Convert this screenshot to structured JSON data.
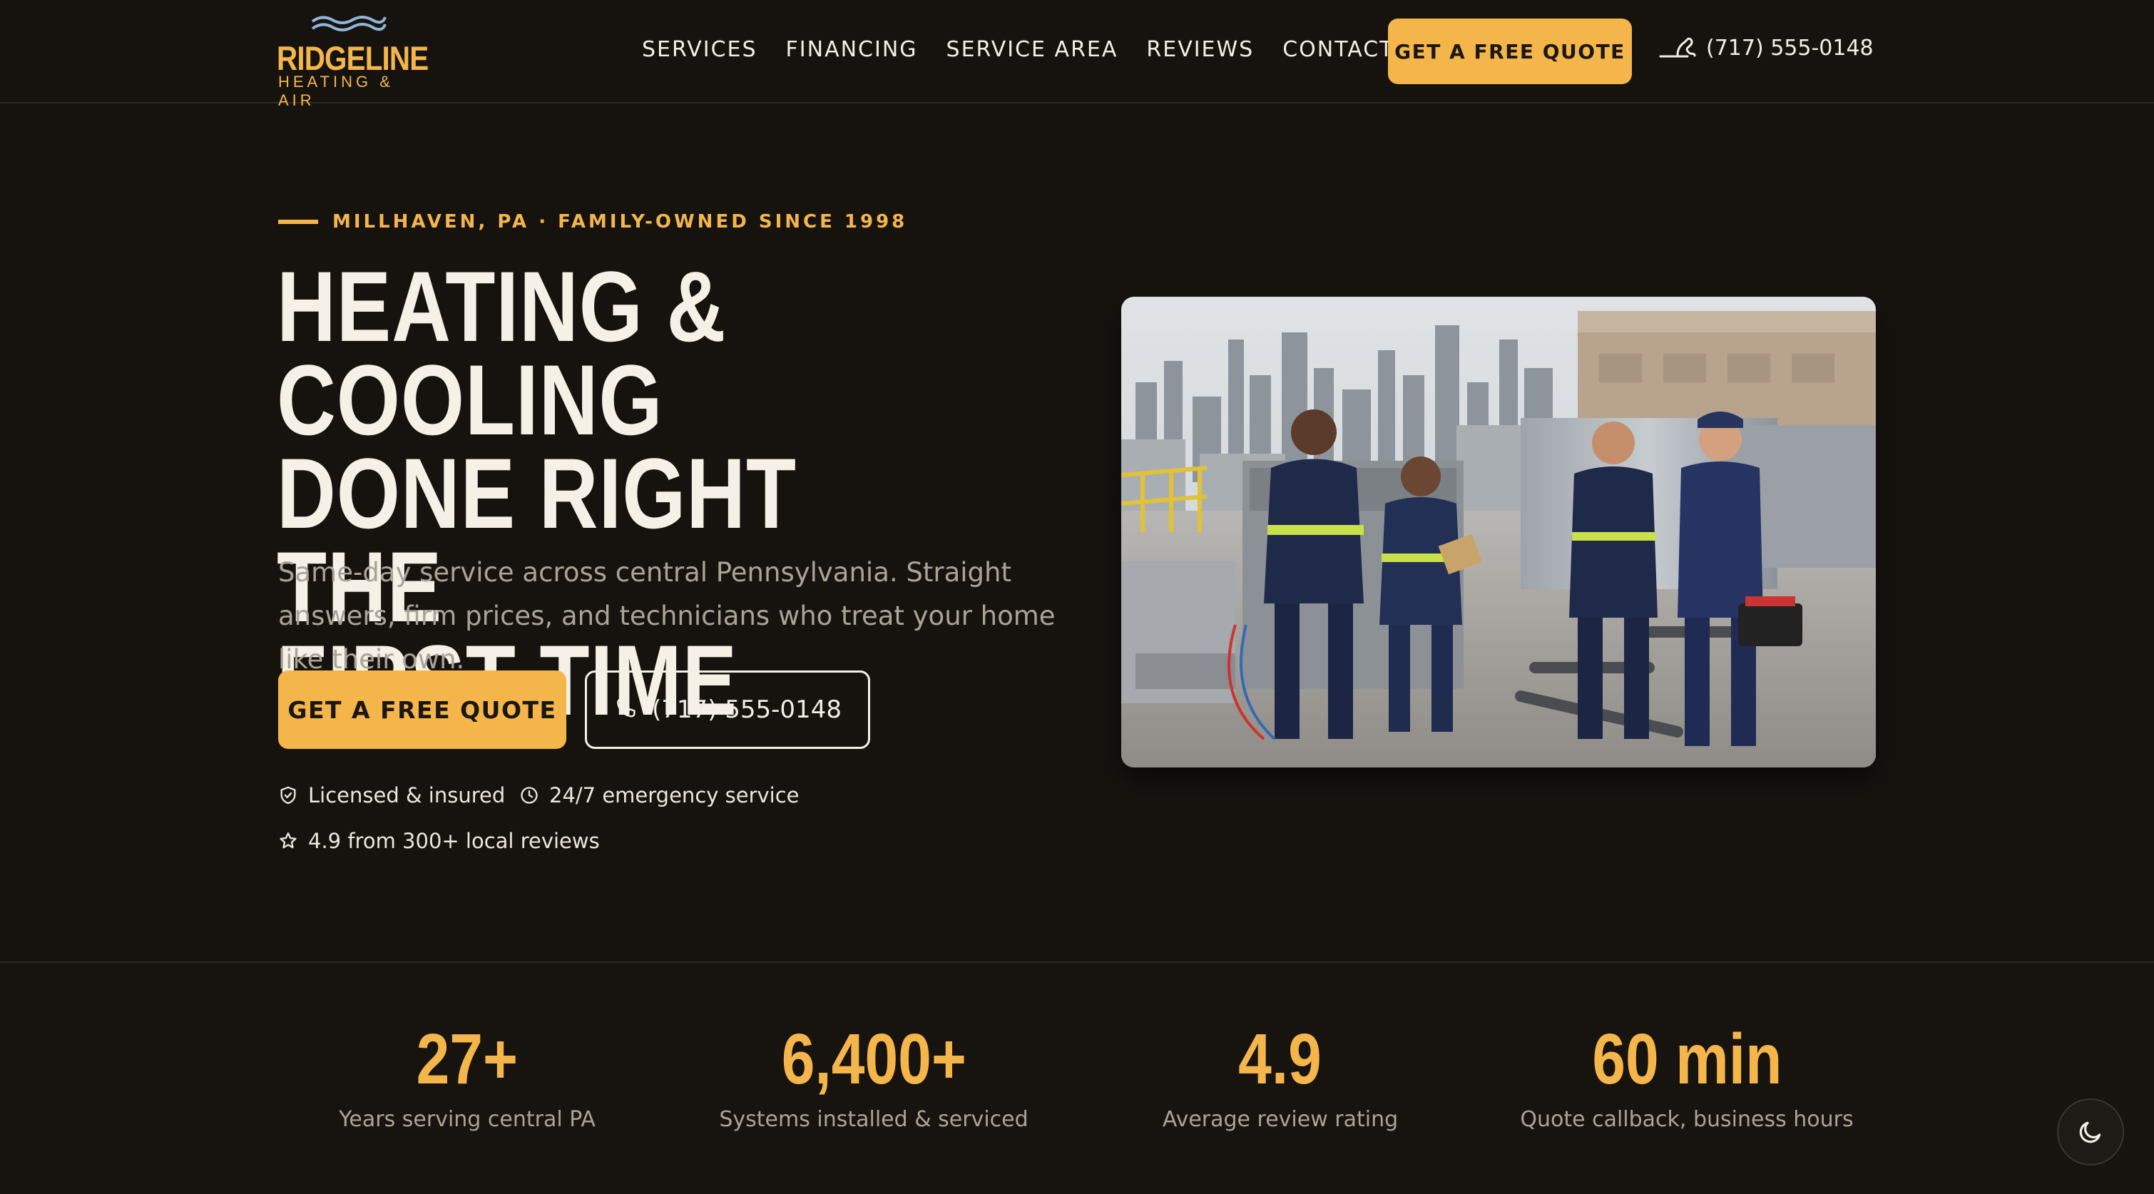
{
  "brand": {
    "name": "RIDGELINE",
    "sub": "HEATING & AIR",
    "colors": {
      "accent": "#f4b64a",
      "background": "#16130f",
      "text": "#f3efe6",
      "muted": "#aaa397"
    }
  },
  "nav": {
    "items": [
      "SERVICES",
      "FINANCING",
      "SERVICE AREA",
      "REVIEWS",
      "CONTACT"
    ],
    "quote_label": "GET A FREE QUOTE",
    "phone": "(717) 555-0148"
  },
  "hero": {
    "eyebrow": "MILLHAVEN, PA · FAMILY-OWNED SINCE 1998",
    "title_line1": "HEATING & COOLING",
    "title_line2": "DONE RIGHT THE",
    "title_line3": "FIRST TIME",
    "subtitle": "Same-day service across central Pennsylvania. Straight answers, firm prices, and technicians who treat your home like their own.",
    "cta_quote": "GET A FREE QUOTE",
    "cta_phone": "(717) 555-0148",
    "trust": [
      {
        "icon": "shield-check-icon",
        "label": "Licensed & insured"
      },
      {
        "icon": "clock-icon",
        "label": "24/7 emergency service"
      },
      {
        "icon": "star-icon",
        "label": "4.9 from 300+ local reviews"
      }
    ]
  },
  "stats": [
    {
      "value": "27+",
      "label": "Years serving central PA"
    },
    {
      "value": "6,400+",
      "label": "Systems installed & serviced"
    },
    {
      "value": "4.9",
      "label": "Average review rating"
    },
    {
      "value": "60 min",
      "label": "Quote callback, business hours"
    }
  ],
  "theme_toggle": {
    "icon": "moon-icon"
  }
}
